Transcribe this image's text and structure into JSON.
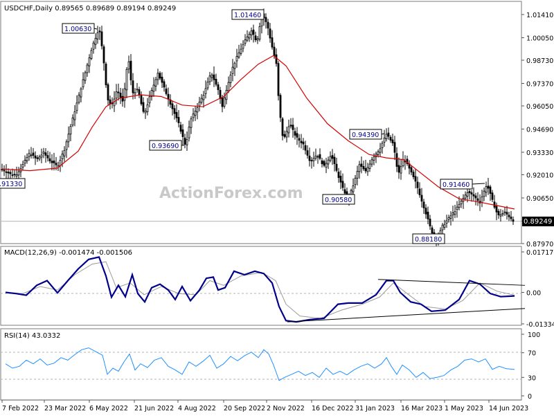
{
  "chart_data": [
    {
      "type": "candlestick",
      "header": "USDCHF,Daily  0.89565 0.89689 0.89194 0.89249",
      "current_price": 0.89249,
      "current_price_label": "0.89249",
      "ylim": [
        0.8797,
        1.0146
      ],
      "y_ticks": [
        "1.01410",
        "1.00050",
        "0.98730",
        "0.97370",
        "0.96050",
        "0.94690",
        "0.93330",
        "0.92010",
        "0.90650",
        "0.89290",
        "0.87970"
      ],
      "x_ticks": [
        "7 Feb 2022",
        "23 Mar 2022",
        "6 May 2022",
        "21 Jun 2022",
        "4 Aug 2022",
        "20 Sep 2022",
        "2 Nov 2022",
        "16 Dec 2022",
        "31 Jan 2023",
        "16 Mar 2023",
        "1 May 2023",
        "14 Jun 2023"
      ],
      "annotations": [
        {
          "label": "1.00630",
          "value": 1.0063
        },
        {
          "label": "1.01460",
          "value": 1.0146
        },
        {
          "label": "0.93690",
          "value": 0.9369
        },
        {
          "label": "0.94390",
          "value": 0.9439
        },
        {
          "label": "0.90580",
          "value": 0.9058
        },
        {
          "label": "0.91460",
          "value": 0.9146
        },
        {
          "label": "0.88180",
          "value": 0.8818
        },
        {
          "label": "0.91330",
          "value": 0.9133
        }
      ],
      "price_path": [
        [
          0,
          0.9233
        ],
        [
          12,
          0.9205
        ],
        [
          20,
          0.92
        ],
        [
          30,
          0.926
        ],
        [
          40,
          0.933
        ],
        [
          50,
          0.929
        ],
        [
          60,
          0.933
        ],
        [
          70,
          0.928
        ],
        [
          80,
          0.925
        ],
        [
          90,
          0.935
        ],
        [
          100,
          0.95
        ],
        [
          110,
          0.965
        ],
        [
          120,
          0.98
        ],
        [
          130,
          0.995
        ],
        [
          140,
          1.0063
        ],
        [
          146,
          0.99
        ],
        [
          152,
          0.965
        ],
        [
          158,
          0.96
        ],
        [
          166,
          0.97
        ],
        [
          175,
          0.962
        ],
        [
          182,
          0.99
        ],
        [
          188,
          0.968
        ],
        [
          196,
          0.97
        ],
        [
          205,
          0.955
        ],
        [
          215,
          0.968
        ],
        [
          225,
          0.98
        ],
        [
          235,
          0.97
        ],
        [
          245,
          0.96
        ],
        [
          255,
          0.95
        ],
        [
          265,
          0.9369
        ],
        [
          272,
          0.952
        ],
        [
          282,
          0.96
        ],
        [
          292,
          0.968
        ],
        [
          302,
          0.98
        ],
        [
          312,
          0.97
        ],
        [
          318,
          0.96
        ],
        [
          325,
          0.972
        ],
        [
          332,
          0.982
        ],
        [
          340,
          0.99
        ],
        [
          350,
          0.998
        ],
        [
          360,
          1.005
        ],
        [
          368,
          0.998
        ],
        [
          375,
          1.0146
        ],
        [
          383,
          1.008
        ],
        [
          390,
          0.995
        ],
        [
          396,
          0.985
        ],
        [
          400,
          0.96
        ],
        [
          406,
          0.94
        ],
        [
          415,
          0.95
        ],
        [
          425,
          0.942
        ],
        [
          435,
          0.938
        ],
        [
          445,
          0.928
        ],
        [
          455,
          0.932
        ],
        [
          465,
          0.925
        ],
        [
          475,
          0.932
        ],
        [
          485,
          0.92
        ],
        [
          492,
          0.912
        ],
        [
          500,
          0.9058
        ],
        [
          508,
          0.915
        ],
        [
          516,
          0.926
        ],
        [
          525,
          0.922
        ],
        [
          535,
          0.93
        ],
        [
          545,
          0.935
        ],
        [
          555,
          0.9439
        ],
        [
          565,
          0.938
        ],
        [
          572,
          0.92
        ],
        [
          580,
          0.93
        ],
        [
          590,
          0.922
        ],
        [
          598,
          0.915
        ],
        [
          606,
          0.905
        ],
        [
          614,
          0.895
        ],
        [
          620,
          0.887
        ],
        [
          628,
          0.8818
        ],
        [
          636,
          0.89
        ],
        [
          646,
          0.895
        ],
        [
          656,
          0.9
        ],
        [
          664,
          0.905
        ],
        [
          672,
          0.91
        ],
        [
          680,
          0.908
        ],
        [
          690,
          0.904
        ],
        [
          700,
          0.9146
        ],
        [
          708,
          0.905
        ],
        [
          716,
          0.896
        ],
        [
          726,
          0.898
        ],
        [
          734,
          0.895
        ],
        [
          740,
          0.8925
        ]
      ],
      "ma_path": [
        [
          0,
          0.9235
        ],
        [
          40,
          0.9225
        ],
        [
          80,
          0.924
        ],
        [
          110,
          0.934
        ],
        [
          130,
          0.948
        ],
        [
          150,
          0.96
        ],
        [
          170,
          0.965
        ],
        [
          200,
          0.967
        ],
        [
          230,
          0.966
        ],
        [
          260,
          0.961
        ],
        [
          290,
          0.96
        ],
        [
          320,
          0.966
        ],
        [
          345,
          0.976
        ],
        [
          370,
          0.985
        ],
        [
          392,
          0.99
        ],
        [
          410,
          0.984
        ],
        [
          440,
          0.965
        ],
        [
          470,
          0.95
        ],
        [
          500,
          0.94
        ],
        [
          530,
          0.932
        ],
        [
          555,
          0.93
        ],
        [
          580,
          0.929
        ],
        [
          605,
          0.921
        ],
        [
          630,
          0.913
        ],
        [
          660,
          0.906
        ],
        [
          690,
          0.904
        ],
        [
          715,
          0.902
        ],
        [
          740,
          0.9
        ]
      ]
    },
    {
      "type": "line",
      "title": "MACD(12,26,9) -0.001474 -0.001506",
      "ylim": [
        -0.0134,
        0.017176
      ],
      "y_ticks": [
        "0.017176",
        "0.00",
        "-0.01334"
      ],
      "macd_path": [
        [
          5,
          0.0
        ],
        [
          20,
          -0.0005
        ],
        [
          35,
          -0.0012
        ],
        [
          50,
          0.003
        ],
        [
          65,
          0.005
        ],
        [
          80,
          -0.0002
        ],
        [
          95,
          0.005
        ],
        [
          110,
          0.01
        ],
        [
          125,
          0.014
        ],
        [
          140,
          0.015
        ],
        [
          150,
          0.007
        ],
        [
          158,
          -0.002
        ],
        [
          168,
          0.003
        ],
        [
          178,
          -0.0018
        ],
        [
          188,
          0.0075
        ],
        [
          196,
          -0.0005
        ],
        [
          206,
          -0.004
        ],
        [
          216,
          0.002
        ],
        [
          228,
          0.0035
        ],
        [
          240,
          0.001
        ],
        [
          250,
          -0.003
        ],
        [
          260,
          0.0025
        ],
        [
          272,
          -0.0035
        ],
        [
          285,
          0.001
        ],
        [
          295,
          0.006
        ],
        [
          305,
          0.0065
        ],
        [
          312,
          0.001
        ],
        [
          322,
          0.002
        ],
        [
          335,
          0.009
        ],
        [
          350,
          0.0075
        ],
        [
          365,
          0.009
        ],
        [
          378,
          0.008
        ],
        [
          390,
          0.004
        ],
        [
          400,
          -0.006
        ],
        [
          410,
          -0.012
        ],
        [
          425,
          -0.0125
        ],
        [
          445,
          -0.0115
        ],
        [
          465,
          -0.011
        ],
        [
          485,
          -0.005
        ],
        [
          500,
          -0.0045
        ],
        [
          520,
          -0.0045
        ],
        [
          540,
          -0.001
        ],
        [
          555,
          0.005
        ],
        [
          565,
          0.005
        ],
        [
          575,
          0.0
        ],
        [
          590,
          -0.004
        ],
        [
          605,
          -0.005
        ],
        [
          620,
          -0.008
        ],
        [
          640,
          -0.0075
        ],
        [
          660,
          -0.003
        ],
        [
          675,
          0.005
        ],
        [
          690,
          0.0035
        ],
        [
          705,
          -0.0005
        ],
        [
          720,
          -0.0018
        ],
        [
          740,
          -0.0015
        ]
      ],
      "signal_path": [
        [
          5,
          0.0
        ],
        [
          30,
          -0.0005
        ],
        [
          55,
          0.0025
        ],
        [
          80,
          0.001
        ],
        [
          105,
          0.0075
        ],
        [
          130,
          0.012
        ],
        [
          150,
          0.013
        ],
        [
          165,
          0.002
        ],
        [
          185,
          0.004
        ],
        [
          205,
          -0.001
        ],
        [
          230,
          0.0025
        ],
        [
          255,
          -0.0005
        ],
        [
          280,
          -0.001
        ],
        [
          300,
          0.005
        ],
        [
          320,
          0.003
        ],
        [
          345,
          0.007
        ],
        [
          375,
          0.0085
        ],
        [
          395,
          0.005
        ],
        [
          410,
          -0.005
        ],
        [
          430,
          -0.01
        ],
        [
          460,
          -0.011
        ],
        [
          490,
          -0.0075
        ],
        [
          520,
          -0.005
        ],
        [
          545,
          -0.002
        ],
        [
          565,
          0.004
        ],
        [
          585,
          -0.0005
        ],
        [
          610,
          -0.006
        ],
        [
          640,
          -0.007
        ],
        [
          665,
          -0.0035
        ],
        [
          690,
          0.004
        ],
        [
          715,
          0.0005
        ],
        [
          740,
          -0.0012
        ]
      ],
      "trendlines": [
        {
          "from": [
            543,
            0.0055
          ],
          "to": [
            755,
            0.003
          ]
        },
        {
          "from": [
            412,
            -0.0125
          ],
          "to": [
            755,
            -0.0068
          ]
        }
      ]
    },
    {
      "type": "line",
      "title": "RSI(14) 43.0332",
      "ylim": [
        0,
        100
      ],
      "y_ticks": [
        "100",
        "70",
        "30",
        "0"
      ],
      "levels": [
        70,
        30
      ],
      "rsi_path": [
        [
          5,
          52
        ],
        [
          15,
          45
        ],
        [
          25,
          48
        ],
        [
          35,
          58
        ],
        [
          45,
          52
        ],
        [
          55,
          60
        ],
        [
          65,
          50
        ],
        [
          75,
          53
        ],
        [
          85,
          62
        ],
        [
          95,
          58
        ],
        [
          105,
          67
        ],
        [
          115,
          75
        ],
        [
          125,
          78
        ],
        [
          135,
          72
        ],
        [
          145,
          66
        ],
        [
          152,
          35
        ],
        [
          160,
          45
        ],
        [
          168,
          40
        ],
        [
          176,
          55
        ],
        [
          184,
          68
        ],
        [
          192,
          42
        ],
        [
          200,
          52
        ],
        [
          210,
          46
        ],
        [
          220,
          58
        ],
        [
          230,
          62
        ],
        [
          240,
          48
        ],
        [
          250,
          42
        ],
        [
          260,
          35
        ],
        [
          270,
          55
        ],
        [
          280,
          48
        ],
        [
          290,
          56
        ],
        [
          300,
          66
        ],
        [
          310,
          45
        ],
        [
          320,
          52
        ],
        [
          330,
          64
        ],
        [
          340,
          57
        ],
        [
          350,
          65
        ],
        [
          360,
          71
        ],
        [
          370,
          62
        ],
        [
          378,
          75
        ],
        [
          385,
          68
        ],
        [
          392,
          50
        ],
        [
          400,
          25
        ],
        [
          408,
          30
        ],
        [
          418,
          35
        ],
        [
          428,
          40
        ],
        [
          438,
          33
        ],
        [
          448,
          38
        ],
        [
          458,
          30
        ],
        [
          468,
          45
        ],
        [
          478,
          35
        ],
        [
          488,
          40
        ],
        [
          498,
          34
        ],
        [
          508,
          42
        ],
        [
          518,
          48
        ],
        [
          528,
          52
        ],
        [
          538,
          45
        ],
        [
          548,
          52
        ],
        [
          555,
          62
        ],
        [
          562,
          48
        ],
        [
          570,
          35
        ],
        [
          578,
          50
        ],
        [
          588,
          42
        ],
        [
          598,
          30
        ],
        [
          608,
          38
        ],
        [
          618,
          28
        ],
        [
          628,
          30
        ],
        [
          638,
          33
        ],
        [
          648,
          42
        ],
        [
          658,
          48
        ],
        [
          668,
          58
        ],
        [
          678,
          60
        ],
        [
          688,
          55
        ],
        [
          698,
          60
        ],
        [
          708,
          43
        ],
        [
          718,
          48
        ],
        [
          728,
          44
        ],
        [
          740,
          43
        ]
      ]
    }
  ],
  "watermark": "ActionForex.com"
}
